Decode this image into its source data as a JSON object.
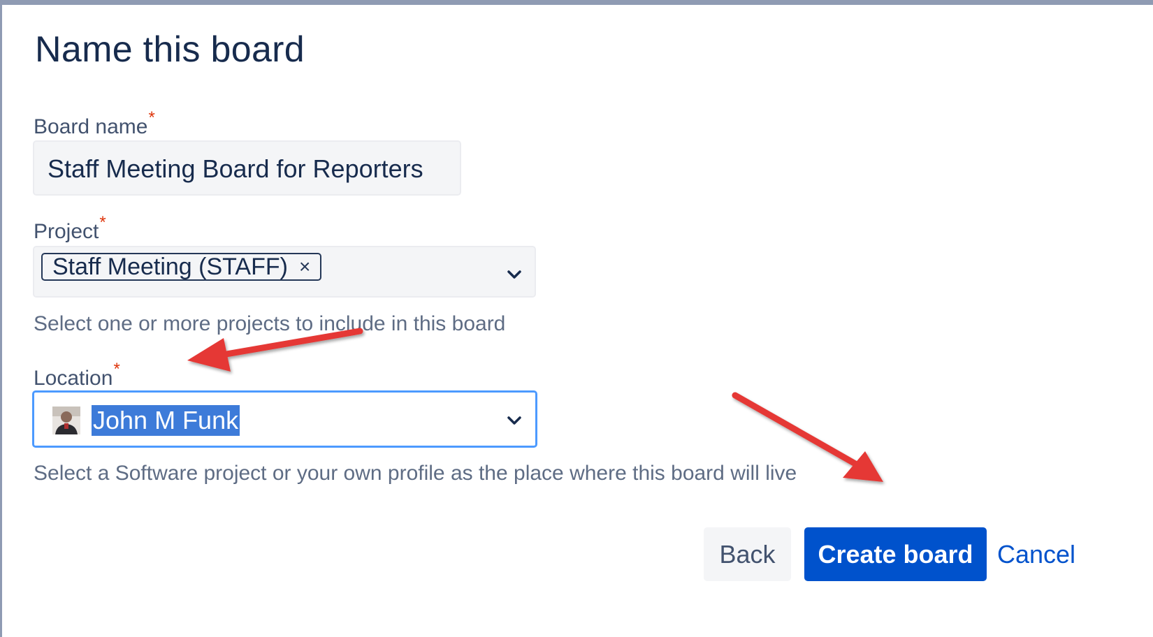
{
  "dialog": {
    "title": "Name this board"
  },
  "board_name": {
    "label": "Board name",
    "required_mark": "*",
    "value": "Staff Meeting Board for Reporters"
  },
  "project": {
    "label": "Project",
    "required_mark": "*",
    "selected_chip": "Staff Meeting (STAFF)",
    "chip_remove": "×",
    "helper": "Select one or more projects to include in this board",
    "icon": "chevron-down-icon"
  },
  "location": {
    "label": "Location",
    "required_mark": "*",
    "value": "John M Funk",
    "helper": "Select a Software project or your own profile as the place where this board will live",
    "icon": "chevron-down-icon",
    "avatar_icon": "user-avatar-icon"
  },
  "actions": {
    "back": "Back",
    "create": "Create board",
    "cancel": "Cancel"
  },
  "colors": {
    "primary": "#0052cc",
    "focus_border": "#4c9aff",
    "required": "#de350b",
    "annotation_arrow": "#e53935"
  }
}
